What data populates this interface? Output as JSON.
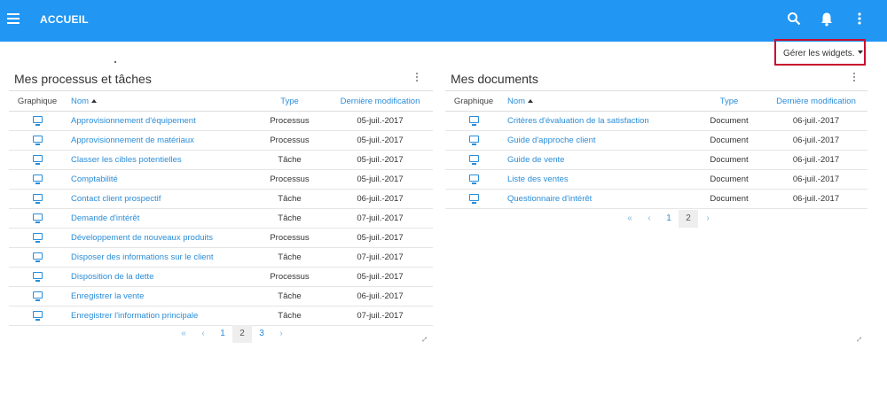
{
  "header": {
    "title": "ACCUEIL",
    "icons": [
      "menu-icon",
      "search-icon",
      "bell-icon",
      "more-vert-icon"
    ]
  },
  "widgets_button": {
    "label": "Gérer les widgets."
  },
  "processes": {
    "title": "Mes processus et tâches",
    "columns": {
      "graphic": "Graphique",
      "name": "Nom",
      "type": "Type",
      "date": "Dernière modification"
    },
    "rows": [
      {
        "name": "Approvisionnement d'équipement",
        "type": "Processus",
        "date": "05-juil.-2017"
      },
      {
        "name": "Approvisionnement de matériaux",
        "type": "Processus",
        "date": "05-juil.-2017"
      },
      {
        "name": "Classer les cibles potentielles",
        "type": "Tâche",
        "date": "05-juil.-2017"
      },
      {
        "name": "Comptabilité",
        "type": "Processus",
        "date": "05-juil.-2017"
      },
      {
        "name": "Contact client prospectif",
        "type": "Tâche",
        "date": "06-juil.-2017"
      },
      {
        "name": "Demande d'intérêt",
        "type": "Tâche",
        "date": "07-juil.-2017"
      },
      {
        "name": "Développement de nouveaux produits",
        "type": "Processus",
        "date": "05-juil.-2017"
      },
      {
        "name": "Disposer des informations sur le client",
        "type": "Tâche",
        "date": "07-juil.-2017"
      },
      {
        "name": "Disposition de la dette",
        "type": "Processus",
        "date": "05-juil.-2017"
      },
      {
        "name": "Enregistrer la vente",
        "type": "Tâche",
        "date": "06-juil.-2017"
      },
      {
        "name": "Enregistrer l'information principale",
        "type": "Tâche",
        "date": "07-juil.-2017"
      }
    ],
    "pager": {
      "first": "«",
      "prev": "‹",
      "pages": [
        "1",
        "2",
        "3"
      ],
      "current": "2",
      "next": "›"
    }
  },
  "documents": {
    "title": "Mes documents",
    "columns": {
      "graphic": "Graphique",
      "name": "Nom",
      "type": "Type",
      "date": "Dernière modification"
    },
    "rows": [
      {
        "name": "Critères d'évaluation de la satisfaction",
        "type": "Document",
        "date": "06-juil.-2017"
      },
      {
        "name": "Guide d'approche client",
        "type": "Document",
        "date": "06-juil.-2017"
      },
      {
        "name": "Guide de vente",
        "type": "Document",
        "date": "06-juil.-2017"
      },
      {
        "name": "Liste des ventes",
        "type": "Document",
        "date": "06-juil.-2017"
      },
      {
        "name": "Questionnaire d'intérêt",
        "type": "Document",
        "date": "06-juil.-2017"
      }
    ],
    "pager": {
      "first": "«",
      "prev": "‹",
      "pages": [
        "1",
        "2"
      ],
      "current": "2",
      "next": "›"
    }
  },
  "colors": {
    "header": "#2196f3",
    "link": "#2a8dd8",
    "highlight": "#c8102e"
  }
}
